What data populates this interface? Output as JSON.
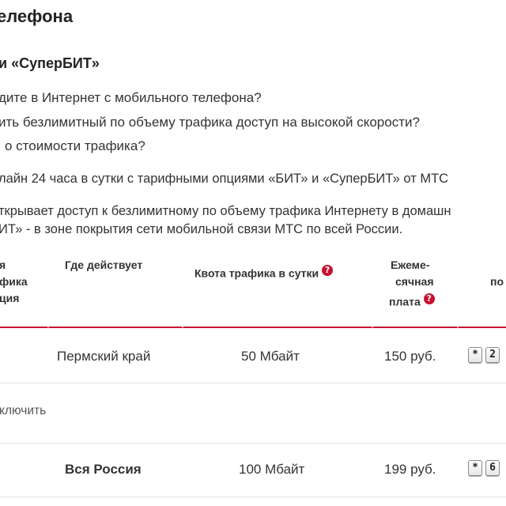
{
  "page": {
    "title": "елефона",
    "section_title": "и «СуперБИТ»",
    "questions": [
      "дите в Интернет с мобильного телефона?",
      "ить безлимитный по объему трафика доступ на высокой скорости?",
      "о стоимости трафика?"
    ],
    "paragraph1": "лайн 24 часа в сутки с тарифными опциями «БИТ» и «СуперБИТ» от МТС",
    "paragraph2_line1": "ткрывает доступ к безлимитному по объему трафика Интернету в домашн",
    "paragraph2_line2": "ИТ» - в зоне покрытия сети мобильной связи МТС по всей России."
  },
  "table": {
    "headers": {
      "col1_lines": [
        "я",
        "фика",
        "ция"
      ],
      "col2": "Где действует",
      "col3": "Квота  трафика в сутки",
      "col4_lines": [
        "Ежеме-",
        "сячная",
        "плата"
      ],
      "col5": "по"
    },
    "help_glyph": "?",
    "rows": [
      {
        "region": "Пермский край",
        "quota": "50 Мбайт",
        "price": "150 руб.",
        "keys": [
          "*",
          "2"
        ]
      },
      {
        "connect_link": "ключить"
      },
      {
        "region": "Вся Россия",
        "quota": "100 Мбайт",
        "price": "199 руб.",
        "keys": [
          "*",
          "6"
        ]
      }
    ]
  },
  "colors": {
    "accent_red": "#c8102e",
    "divider": "#e2e2e2"
  },
  "icons": [
    "help-icon",
    "key-asterisk-icon",
    "key-digit-icon"
  ]
}
